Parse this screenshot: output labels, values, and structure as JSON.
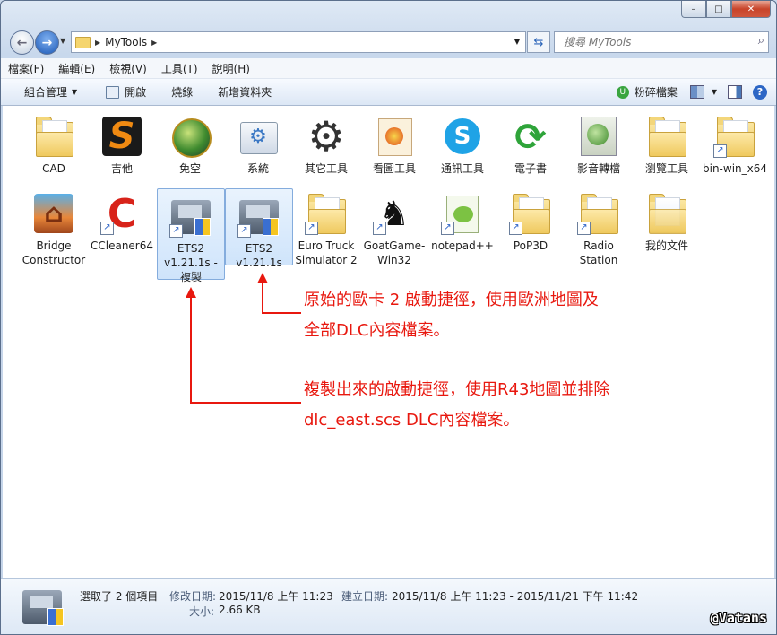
{
  "window": {
    "caption_buttons": {
      "minimize": "–",
      "maximize": "□",
      "close": "✕"
    }
  },
  "address": {
    "path": "MyTools",
    "search_placeholder": "搜尋 MyTools"
  },
  "menu": [
    "檔案(F)",
    "編輯(E)",
    "檢視(V)",
    "工具(T)",
    "說明(H)"
  ],
  "commands": {
    "organize": "組合管理",
    "open": "開啟",
    "burn": "燒錄",
    "new_folder": "新增資料夾",
    "shred": "粉碎檔案"
  },
  "items": [
    {
      "label": "CAD",
      "icon": "folder-icon"
    },
    {
      "label": "吉他",
      "icon": "guitar-app-icon"
    },
    {
      "label": "免空",
      "icon": "globe-app-icon"
    },
    {
      "label": "系統",
      "icon": "system-app-icon"
    },
    {
      "label": "其它工具",
      "icon": "gear-app-icon"
    },
    {
      "label": "看圖工具",
      "icon": "image-viewer-icon"
    },
    {
      "label": "通訊工具",
      "icon": "skype-icon"
    },
    {
      "label": "電子書",
      "icon": "ebook-app-icon"
    },
    {
      "label": "影音轉檔",
      "icon": "media-convert-icon"
    },
    {
      "label": "瀏覽工具",
      "icon": "folder-icon"
    },
    {
      "label": "bin-win_x64",
      "icon": "folder-shortcut-icon"
    },
    {
      "label": "Bridge Constructor",
      "icon": "bridge-game-icon"
    },
    {
      "label": "CCleaner64",
      "icon": "ccleaner-icon"
    },
    {
      "label": "ETS2 v1.21.1s - 複製",
      "icon": "ets2-truck-icon"
    },
    {
      "label": "ETS2 v1.21.1s",
      "icon": "ets2-truck-icon"
    },
    {
      "label": "Euro Truck Simulator 2",
      "icon": "folder-shortcut-icon"
    },
    {
      "label": "GoatGame-Win32",
      "icon": "goat-icon"
    },
    {
      "label": "notepad++",
      "icon": "notepadpp-icon"
    },
    {
      "label": "PoP3D",
      "icon": "folder-shortcut-icon"
    },
    {
      "label": "Radio Station",
      "icon": "folder-shortcut-icon"
    },
    {
      "label": "我的文件",
      "icon": "documents-folder-icon"
    }
  ],
  "annotations": {
    "original_line1": "原始的歐卡 2 啟動捷徑，使用歐洲地圖及",
    "original_line2": "全部DLC內容檔案。",
    "copy_line1": "複製出來的啟動捷徑，使用R43地圖並排除",
    "copy_line2": "dlc_east.scs DLC內容檔案。",
    "color": "#e8180f"
  },
  "details": {
    "selected": "選取了 2 個項目",
    "modified_label": "修改日期:",
    "modified_value": "2015/11/8 上午 11:23",
    "created_label": "建立日期:",
    "created_value": "2015/11/8 上午 11:23 - 2015/11/21 下午 11:42",
    "size_label": "大小:",
    "size_value": "2.66 KB"
  },
  "watermark": "@Vatans"
}
